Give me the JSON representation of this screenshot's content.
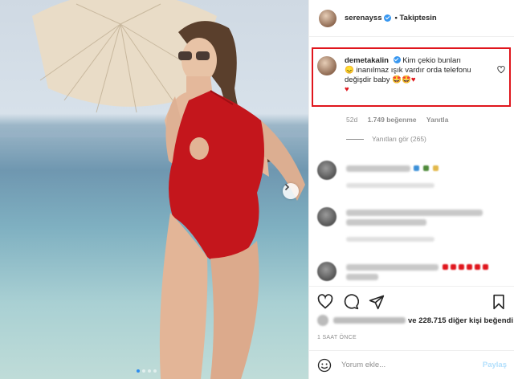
{
  "post": {
    "author": "serenayss",
    "follow_status": "• Takiptesin"
  },
  "highlighted_comment": {
    "username": "demetakalin",
    "text_part1": "Kim çekio bunları",
    "text_part2": "inanılmaz ışık vardır orda telefonu değişdir baby",
    "age": "52d",
    "likes": "1.749 beğenme",
    "reply_label": "Yanıtla",
    "view_replies": "Yanıtları gör (265)"
  },
  "likes_summary": {
    "suffix": "ve 228.715 diğer kişi beğendi"
  },
  "timestamp": "1 SAAT ÖNCE",
  "comment_box": {
    "placeholder": "Yorum ekle...",
    "share_label": "Paylaş"
  },
  "icons": [
    "heart-icon",
    "comment-icon",
    "share-icon",
    "bookmark-icon",
    "chevron-right-icon",
    "emoji-icon"
  ],
  "colors": {
    "verified": "#3897f0",
    "highlight": "#e0161d",
    "swimsuit": "#c4161c"
  }
}
